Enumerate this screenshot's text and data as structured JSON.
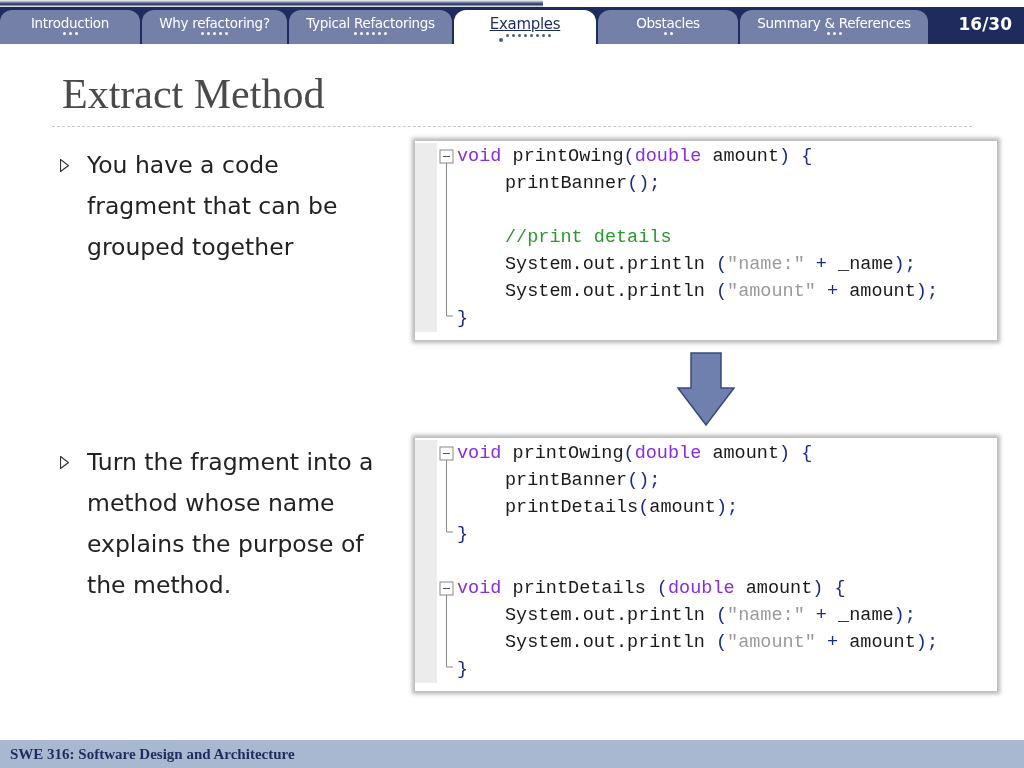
{
  "progress": {
    "level": 0.53
  },
  "tabs": [
    {
      "label": "Introduction",
      "selected": false,
      "dots": [
        {
          "current": false
        },
        {
          "current": false
        },
        {
          "current": false
        }
      ]
    },
    {
      "label": "Why refactoring?",
      "selected": false,
      "dots": [
        {
          "current": false
        },
        {
          "current": false
        },
        {
          "current": false
        },
        {
          "current": false
        },
        {
          "current": false
        }
      ]
    },
    {
      "label": "Typical Refactorings",
      "selected": false,
      "dots": [
        {
          "current": false
        },
        {
          "current": false
        },
        {
          "current": false
        },
        {
          "current": false
        },
        {
          "current": false
        },
        {
          "current": false
        }
      ]
    },
    {
      "label": "Examples",
      "selected": true,
      "dots": [
        {
          "current": true
        },
        {
          "current": false
        },
        {
          "current": false
        },
        {
          "current": false
        },
        {
          "current": false
        },
        {
          "current": false
        },
        {
          "current": false
        },
        {
          "current": false
        },
        {
          "current": false
        }
      ]
    },
    {
      "label": "Obstacles",
      "selected": false,
      "dots": [
        {
          "current": false
        },
        {
          "current": false
        }
      ]
    },
    {
      "label": "Summary & References",
      "selected": false,
      "dots": [
        {
          "current": false
        },
        {
          "current": false
        },
        {
          "current": false
        }
      ]
    }
  ],
  "page_number": "16/30",
  "title": "Extract Method",
  "bullets": [
    "You have a code fragment that can be grouped together",
    "Turn the fragment into a method whose name explains the purpose of the method."
  ],
  "code_blocks": [
    {
      "functions": [
        {
          "lines": [
            {
              "kind": "code",
              "indented": false,
              "tokens": [
                {
                  "kind": "keyword",
                  "text": "void"
                },
                {
                  "kind": "plain",
                  "text": " printOwing"
                },
                {
                  "kind": "punct",
                  "text": "("
                },
                {
                  "kind": "keyword",
                  "text": "double"
                },
                {
                  "kind": "plain",
                  "text": " amount"
                },
                {
                  "kind": "punct",
                  "text": ") {"
                }
              ]
            },
            {
              "kind": "code",
              "indented": true,
              "tokens": [
                {
                  "kind": "plain",
                  "text": "printBanner"
                },
                {
                  "kind": "punct",
                  "text": "();"
                }
              ]
            },
            {
              "kind": "blank"
            },
            {
              "kind": "code",
              "indented": true,
              "tokens": [
                {
                  "kind": "comment",
                  "text": "//print details"
                }
              ]
            },
            {
              "kind": "code",
              "indented": true,
              "tokens": [
                {
                  "kind": "plain",
                  "text": "System.out.println "
                },
                {
                  "kind": "punct",
                  "text": "("
                },
                {
                  "kind": "string",
                  "text": "\"name:\""
                },
                {
                  "kind": "punct",
                  "text": " + "
                },
                {
                  "kind": "plain",
                  "text": "_name"
                },
                {
                  "kind": "punct",
                  "text": ");"
                }
              ]
            },
            {
              "kind": "code",
              "indented": true,
              "tokens": [
                {
                  "kind": "plain",
                  "text": "System.out.println "
                },
                {
                  "kind": "punct",
                  "text": "("
                },
                {
                  "kind": "string",
                  "text": "\"amount\""
                },
                {
                  "kind": "punct",
                  "text": " + "
                },
                {
                  "kind": "plain",
                  "text": "amount"
                },
                {
                  "kind": "punct",
                  "text": ");"
                }
              ]
            },
            {
              "kind": "code",
              "indented": false,
              "tokens": [
                {
                  "kind": "punct",
                  "text": "}"
                }
              ]
            }
          ]
        }
      ]
    },
    {
      "functions": [
        {
          "lines": [
            {
              "kind": "code",
              "indented": false,
              "tokens": [
                {
                  "kind": "keyword",
                  "text": "void"
                },
                {
                  "kind": "plain",
                  "text": " printOwing"
                },
                {
                  "kind": "punct",
                  "text": "("
                },
                {
                  "kind": "keyword",
                  "text": "double"
                },
                {
                  "kind": "plain",
                  "text": " amount"
                },
                {
                  "kind": "punct",
                  "text": ") {"
                }
              ]
            },
            {
              "kind": "code",
              "indented": true,
              "tokens": [
                {
                  "kind": "plain",
                  "text": "printBanner"
                },
                {
                  "kind": "punct",
                  "text": "();"
                }
              ]
            },
            {
              "kind": "code",
              "indented": true,
              "tokens": [
                {
                  "kind": "plain",
                  "text": "printDetails"
                },
                {
                  "kind": "punct",
                  "text": "("
                },
                {
                  "kind": "plain",
                  "text": "amount"
                },
                {
                  "kind": "punct",
                  "text": ");"
                }
              ]
            },
            {
              "kind": "code",
              "indented": false,
              "tokens": [
                {
                  "kind": "punct",
                  "text": "}"
                }
              ]
            }
          ]
        },
        {
          "lines": [
            {
              "kind": "code",
              "indented": false,
              "tokens": [
                {
                  "kind": "keyword",
                  "text": "void"
                },
                {
                  "kind": "plain",
                  "text": " printDetails "
                },
                {
                  "kind": "punct",
                  "text": "("
                },
                {
                  "kind": "keyword",
                  "text": "double"
                },
                {
                  "kind": "plain",
                  "text": " amount"
                },
                {
                  "kind": "punct",
                  "text": ") {"
                }
              ]
            },
            {
              "kind": "code",
              "indented": true,
              "tokens": [
                {
                  "kind": "plain",
                  "text": "System.out.println "
                },
                {
                  "kind": "punct",
                  "text": "("
                },
                {
                  "kind": "string",
                  "text": "\"name:\""
                },
                {
                  "kind": "punct",
                  "text": " + "
                },
                {
                  "kind": "plain",
                  "text": "_name"
                },
                {
                  "kind": "punct",
                  "text": ");"
                }
              ]
            },
            {
              "kind": "code",
              "indented": true,
              "tokens": [
                {
                  "kind": "plain",
                  "text": "System.out.println "
                },
                {
                  "kind": "punct",
                  "text": "("
                },
                {
                  "kind": "string",
                  "text": "\"amount\""
                },
                {
                  "kind": "punct",
                  "text": " + "
                },
                {
                  "kind": "plain",
                  "text": "amount"
                },
                {
                  "kind": "punct",
                  "text": ");"
                }
              ]
            },
            {
              "kind": "code",
              "indented": false,
              "tokens": [
                {
                  "kind": "punct",
                  "text": "}"
                }
              ]
            }
          ]
        }
      ]
    }
  ],
  "footer": "SWE 316: Software Design and Architecture"
}
